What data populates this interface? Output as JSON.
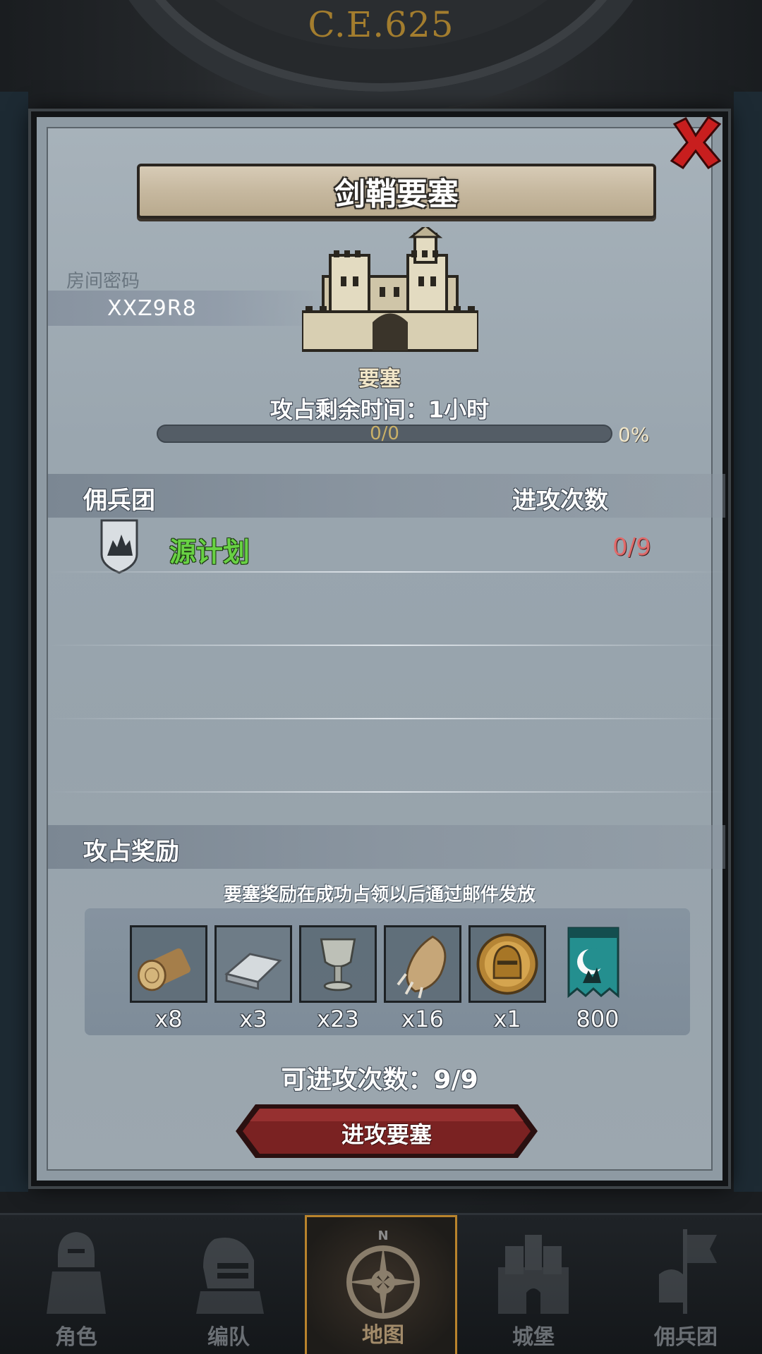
{
  "header": {
    "era": "C.E.625"
  },
  "modal": {
    "title": "剑鞘要塞",
    "room_code_label": "房间密码",
    "room_code": "XXZ9R8",
    "fortress_type": "要塞",
    "remaining_time": "攻占剩余时间：1小时",
    "progress": {
      "text": "0/0",
      "percent_label": "0%",
      "fraction": 0
    },
    "guild_section": {
      "title": "佣兵团",
      "attacks_header": "进攻次数",
      "rows": [
        {
          "name": "源计划",
          "attacks": "0/9",
          "name_color": "#68d144",
          "attacks_color": "#e06a6a"
        }
      ]
    },
    "reward_section": {
      "title": "攻占奖励",
      "note": "要塞奖励在成功占领以后通过邮件发放",
      "items": [
        {
          "icon": "wood-log-icon",
          "qty": "x8"
        },
        {
          "icon": "iron-ingot-icon",
          "qty": "x3"
        },
        {
          "icon": "chalice-icon",
          "qty": "x23"
        },
        {
          "icon": "beast-claw-icon",
          "qty": "x16"
        },
        {
          "icon": "knight-helmet-medal-icon",
          "qty": "x1"
        },
        {
          "icon": "guild-banner-icon",
          "qty": "800"
        }
      ]
    },
    "remaining_attacks": "可进攻次数：9/9",
    "attack_button": "进攻要塞"
  },
  "bottom_nav": {
    "items": [
      {
        "label": "角色",
        "icon": "knight-character-icon",
        "active": false
      },
      {
        "label": "编队",
        "icon": "helmet-formation-icon",
        "active": false
      },
      {
        "label": "地图",
        "icon": "compass-map-icon",
        "active": true,
        "north": "N"
      },
      {
        "label": "城堡",
        "icon": "castle-icon",
        "active": false
      },
      {
        "label": "佣兵团",
        "icon": "mercenary-banner-icon",
        "active": false
      }
    ]
  },
  "colors": {
    "accent_gold": "#b9832c",
    "attack_button": "#7a2222",
    "close_red": "#c81e1e"
  }
}
